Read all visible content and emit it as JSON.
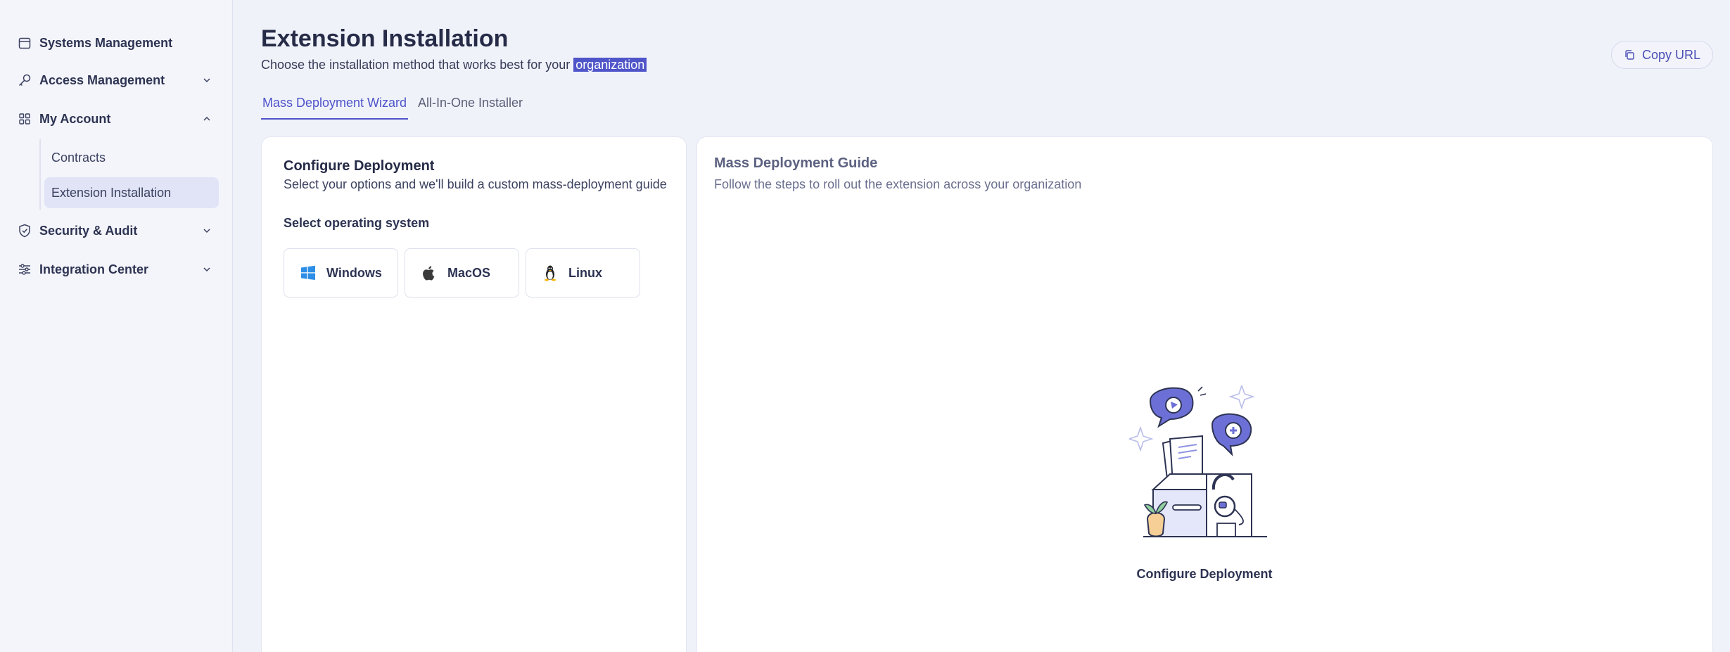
{
  "sidebar": {
    "items": [
      {
        "label": "Systems Management",
        "icon": "calendar-icon"
      },
      {
        "label": "Access Management",
        "icon": "key-icon"
      },
      {
        "label": "My Account",
        "icon": "grid-icon"
      },
      {
        "label": "Security & Audit",
        "icon": "shield-icon"
      },
      {
        "label": "Integration Center",
        "icon": "integration-icon"
      }
    ],
    "sub_items": [
      {
        "label": "Contracts"
      },
      {
        "label": "Extension Installation",
        "active": true
      }
    ]
  },
  "header": {
    "title": "Extension Installation",
    "subtitle_prefix": "Choose the installation method that works best for your",
    "subtitle_highlight": "organization",
    "copy_url_label": "Copy URL"
  },
  "tabs": [
    {
      "label": "Mass Deployment Wizard",
      "active": true
    },
    {
      "label": "All-In-One Installer",
      "active": false
    }
  ],
  "configure": {
    "title": "Configure Deployment",
    "subtitle": "Select your options and we'll build a custom mass-deployment guide",
    "os_label": "Select operating system",
    "os_options": [
      {
        "label": "Windows",
        "icon": "windows-icon"
      },
      {
        "label": "MacOS",
        "icon": "apple-icon"
      },
      {
        "label": "Linux",
        "icon": "linux-icon"
      }
    ]
  },
  "guide": {
    "title": "Mass Deployment Guide",
    "subtitle": "Follow the steps to roll out the extension across your organization",
    "empty_caption": "Configure Deployment"
  },
  "colors": {
    "accent": "#4d53c9",
    "highlight_bg": "#4f55c8",
    "sidebar_active_bg": "#e1e4f6",
    "page_bg": "#f0f2fa"
  }
}
